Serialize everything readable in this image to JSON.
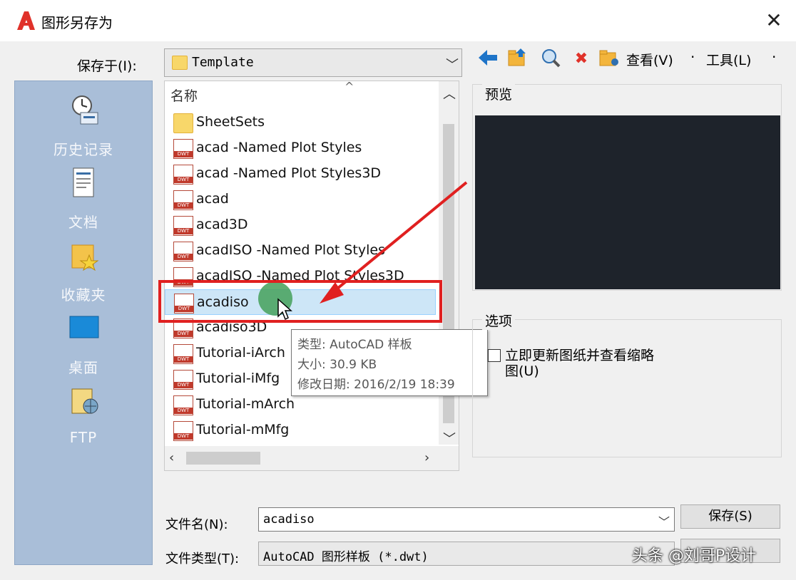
{
  "window": {
    "title": "图形另存为",
    "close_glyph": "✕"
  },
  "save_in": {
    "label": "保存于(I):",
    "value": "Template"
  },
  "toolbar": {
    "view_label": "查看(V)",
    "tools_label": "工具(L)"
  },
  "places": [
    {
      "label": "历史记录",
      "icon": "history-icon"
    },
    {
      "label": "文档",
      "icon": "document-icon"
    },
    {
      "label": "收藏夹",
      "icon": "favorites-folder-icon"
    },
    {
      "label": "桌面",
      "icon": "desktop-icon"
    },
    {
      "label": "FTP",
      "icon": "ftp-icon"
    }
  ],
  "file_list": {
    "column_header": "名称",
    "files": [
      {
        "name": "SheetSets",
        "type": "folder"
      },
      {
        "name": "acad -Named Plot Styles",
        "type": "dwt"
      },
      {
        "name": "acad -Named Plot Styles3D",
        "type": "dwt"
      },
      {
        "name": "acad",
        "type": "dwt"
      },
      {
        "name": "acad3D",
        "type": "dwt"
      },
      {
        "name": "acadISO -Named Plot Styles",
        "type": "dwt"
      },
      {
        "name": "acadISO -Named Plot Styles3D",
        "type": "dwt"
      },
      {
        "name": "acadiso",
        "type": "dwt",
        "selected": true
      },
      {
        "name": "acadiso3D",
        "type": "dwt"
      },
      {
        "name": "Tutorial-iArch",
        "type": "dwt"
      },
      {
        "name": "Tutorial-iMfg",
        "type": "dwt"
      },
      {
        "name": "Tutorial-mArch",
        "type": "dwt"
      },
      {
        "name": "Tutorial-mMfg",
        "type": "dwt"
      }
    ]
  },
  "tooltip": {
    "type_line": "类型: AutoCAD 样板",
    "size_line": "大小: 30.9 KB",
    "date_line": "修改日期: 2016/2/19 18:39"
  },
  "preview": {
    "label": "预览"
  },
  "options": {
    "label": "选项",
    "update_thumbnail_label": "立即更新图纸并查看缩略图(U)",
    "update_thumbnail_checked": false
  },
  "filename": {
    "label": "文件名(N):",
    "value": "acadiso"
  },
  "filetype": {
    "label": "文件类型(T):",
    "value": "AutoCAD 图形样板 (*.dwt)"
  },
  "buttons": {
    "save_label": "保存(S)"
  },
  "watermark": "头条 @刘哥P设计",
  "colors": {
    "highlight": "#e02020",
    "places_bg": "#a9bed8",
    "selection": "#cde6f7",
    "preview_bg": "#1e232b"
  }
}
